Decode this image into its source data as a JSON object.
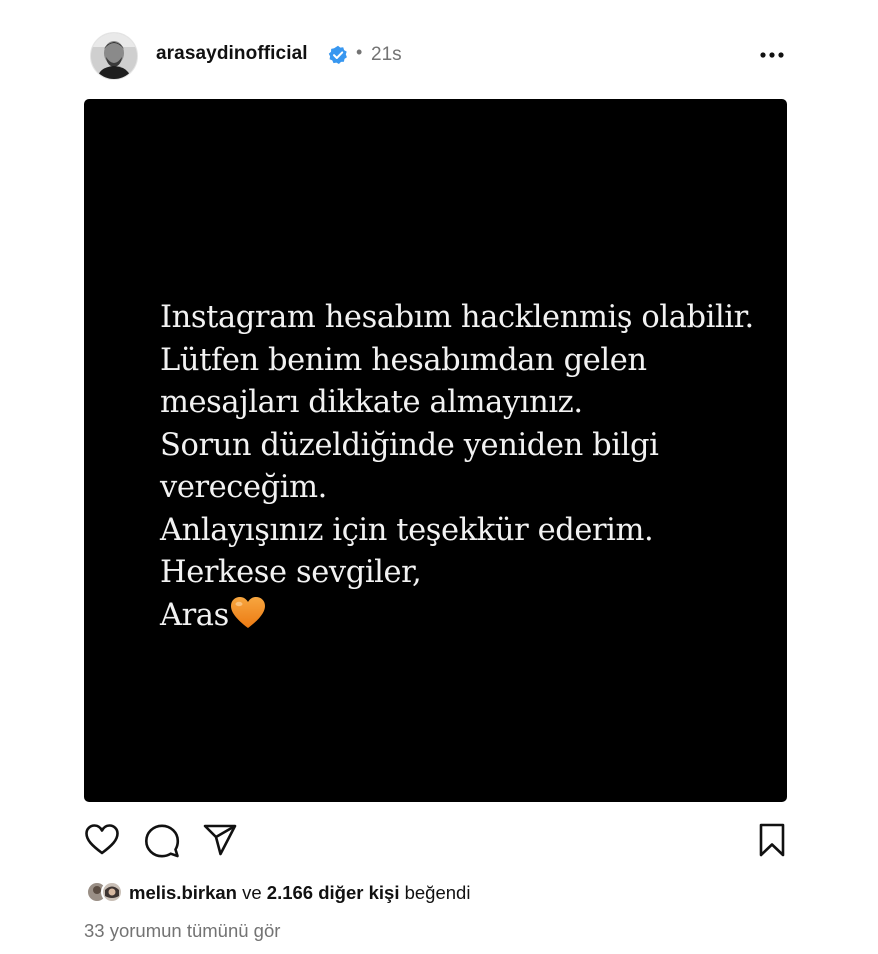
{
  "header": {
    "username": "arasaydinofficial",
    "time_separator": "•",
    "time": "21s",
    "verified_icon": "verified-badge-icon",
    "more_icon": "more-horizontal-icon"
  },
  "media": {
    "lines": [
      "Instagram hesabım hacklenmiş olabilir.",
      "Lütfen benim hesabımdan gelen",
      "mesajları dikkate almayınız.",
      "Sorun düzeldiğinde yeniden bilgi",
      "vereceğim.",
      "Anlayışınız için teşekkür ederim.",
      "Herkese sevgiler,",
      "Aras"
    ],
    "emoji": "orange-heart-icon",
    "background": "#000000",
    "text_color": "#f2f2f2"
  },
  "actions": {
    "like_icon": "heart-outline-icon",
    "comment_icon": "comment-bubble-icon",
    "share_icon": "send-paper-plane-icon",
    "save_icon": "bookmark-outline-icon"
  },
  "likes": {
    "user": "melis.birkan",
    "connector": "ve",
    "others": "2.166 diğer kişi",
    "suffix": "beğendi"
  },
  "comments": {
    "label": "33 yorumun tümünü gör"
  },
  "colors": {
    "verified_blue": "#3897f0",
    "secondary_text": "#737373",
    "heart_orange": "#f28c1c"
  }
}
